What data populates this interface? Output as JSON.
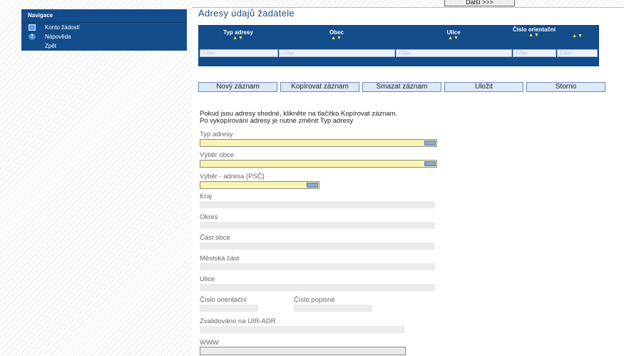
{
  "navigation": {
    "title": "Navigace",
    "items": [
      {
        "label": "Konto žádostí",
        "icon": "grid-icon"
      },
      {
        "label": "Nápověda",
        "icon": "help-icon"
      },
      {
        "label": "Zpět",
        "icon": ""
      }
    ]
  },
  "toolbar": {
    "next_label": "Další >>>"
  },
  "page": {
    "title": "Adresy údajů žadatele"
  },
  "grid": {
    "columns": [
      {
        "label": "Typ adresy",
        "sort": "▲▼"
      },
      {
        "label": "Obec",
        "sort": "▲▼"
      },
      {
        "label": "Ulice",
        "sort": "▲▼"
      },
      {
        "label": "Číslo orientační",
        "sort": "▲▼"
      },
      {
        "label": "",
        "sort": "▲▼"
      }
    ],
    "filter_placeholder": "Filter"
  },
  "actions": {
    "new": "Nový záznam",
    "copy": "Kopírovat záznam",
    "delete": "Smazat záznam",
    "save": "Uložit",
    "cancel": "Storno"
  },
  "info": {
    "line1": "Pokud jsou adresy shodné, klikněte na tlačítko Kopírovat záznam.",
    "line2": "Po vykopírování adresy je nutné změnit Typ adresy"
  },
  "form": {
    "typ_adresy": "Typ adresy",
    "vyber_obce": "Výběr obce",
    "vyber_adresa": "Výběr - adresa (PSČ)",
    "kraj": "Kraj",
    "okres": "Okres",
    "cast_obce": "Část obce",
    "mestska_cast": "Městská část",
    "ulice": "Ulice",
    "cislo_orientacni": "Číslo orientační",
    "cislo_popisne": "Číslo popisné",
    "zvalidovano": "Zvalidováno na UIR-ADR",
    "www": "WWW"
  }
}
